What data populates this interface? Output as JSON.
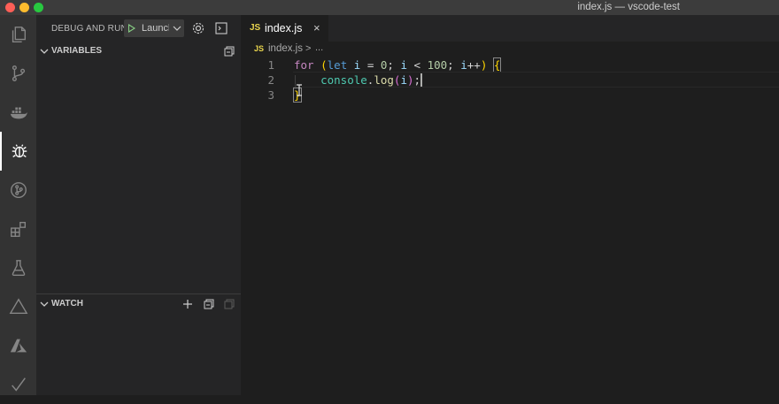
{
  "window": {
    "title": "index.js — vscode-test"
  },
  "activity_bar": [
    {
      "name": "explorer-icon"
    },
    {
      "name": "source-control-icon"
    },
    {
      "name": "docker-icon"
    },
    {
      "name": "debug-icon",
      "active": true
    },
    {
      "name": "git-graph-icon"
    },
    {
      "name": "extensions-icon"
    },
    {
      "name": "test-flask-icon"
    },
    {
      "name": "triangle-icon"
    },
    {
      "name": "azure-icon"
    },
    {
      "name": "checkmark-icon"
    }
  ],
  "sidebar": {
    "title": "DEBUG AND RUN",
    "launch_config": "Launch",
    "variables_label": "VARIABLES",
    "watch_label": "WATCH"
  },
  "editor": {
    "tab_badge": "JS",
    "tab_label": "index.js",
    "tab_close": "×",
    "breadcrumb_file": "index.js",
    "breadcrumb_sep": ">",
    "breadcrumb_more": "...",
    "line_numbers": [
      "1",
      "2",
      "3"
    ],
    "code_tokens": {
      "l1_for": "for",
      "l1_open": "(",
      "l1_let": "let",
      "l1_i1": "i",
      "l1_eq": "=",
      "l1_zero": "0",
      "l1_semi1": ";",
      "l1_i2": "i",
      "l1_lt": "<",
      "l1_hundred": "100",
      "l1_semi2": ";",
      "l1_i3": "i",
      "l1_inc": "++",
      "l1_close": ")",
      "l1_brace": "{",
      "l2_console": "console",
      "l2_dot": ".",
      "l2_log": "log",
      "l2_open": "(",
      "l2_i": "i",
      "l2_close": ")",
      "l2_semi": ";",
      "l3_brace": "}"
    }
  },
  "colors": {
    "keyword": "#c586c0",
    "storage": "#569cd6",
    "variable": "#9cdcfe",
    "number": "#b5cea8",
    "function": "#dcdcaa",
    "class": "#4ec9b0",
    "bracket_gold": "#ffd700",
    "bracket_orchid": "#da70d6"
  }
}
